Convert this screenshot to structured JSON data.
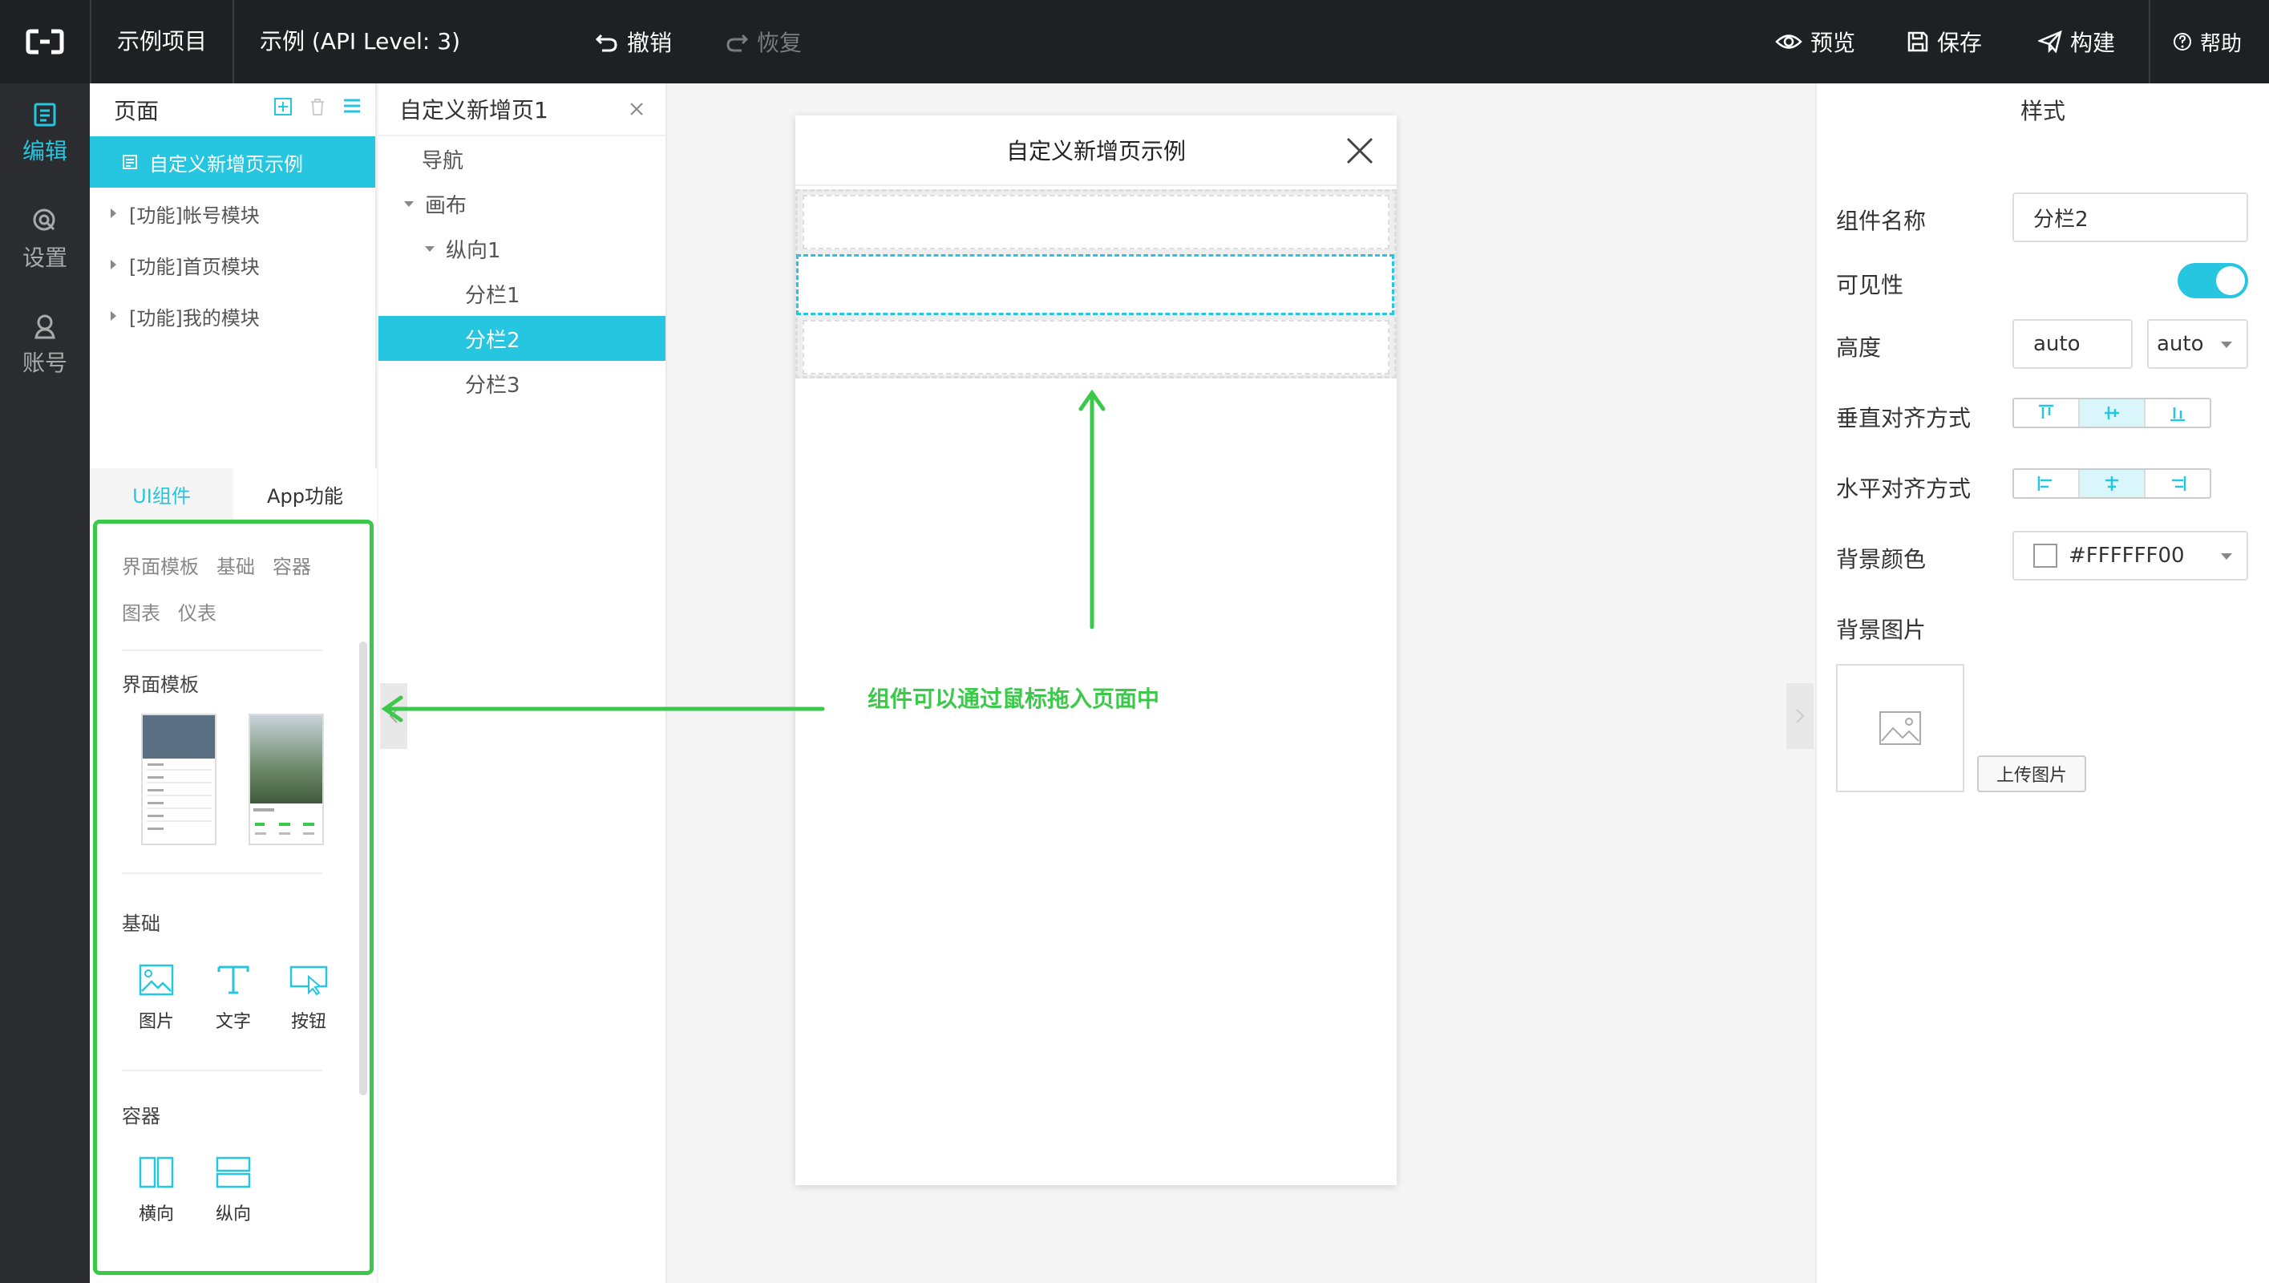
{
  "topbar": {
    "project": "示例项目",
    "example": "示例 (API Level: 3)",
    "undo": "撤销",
    "redo": "恢复",
    "preview": "预览",
    "save": "保存",
    "build": "构建",
    "help": "帮助"
  },
  "leftnav": {
    "edit": "编辑",
    "settings": "设置",
    "account": "账号"
  },
  "pages": {
    "header": "页面",
    "items": [
      {
        "label": "自定义新增页示例"
      },
      {
        "label": "[功能]帐号模块"
      },
      {
        "label": "[功能]首页模块"
      },
      {
        "label": "[功能]我的模块"
      }
    ]
  },
  "comptabs": {
    "ui": "UI组件",
    "app": "App功能"
  },
  "complib": {
    "cat1": "界面模板",
    "cat2": "基础",
    "cat3": "容器",
    "cat4": "图表",
    "cat5": "仪表",
    "sect_template": "界面模板",
    "sect_basic": "基础",
    "sect_container": "容器",
    "basic": [
      "图片",
      "文字",
      "按钮"
    ],
    "container": [
      "横向",
      "纵向"
    ]
  },
  "tree": {
    "title": "自定义新增页1",
    "nav": "导航",
    "canvas": "画布",
    "vertical": "纵向1",
    "col1": "分栏1",
    "col2": "分栏2",
    "col3": "分栏3"
  },
  "phone": {
    "title": "自定义新增页示例"
  },
  "annotation": "组件可以通过鼠标拖入页面中",
  "style": {
    "header": "样式",
    "name_label": "组件名称",
    "name_value": "分栏2",
    "visible_label": "可见性",
    "visible": true,
    "height_label": "高度",
    "height_value": "auto",
    "height_unit": "auto",
    "valign_label": "垂直对齐方式",
    "halign_label": "水平对齐方式",
    "bg_color_label": "背景颜色",
    "bg_color_value": "#FFFFFF00",
    "bg_image_label": "背景图片",
    "upload": "上传图片"
  },
  "colors": {
    "accent": "#26c6e0",
    "annotation": "#3cc84b",
    "topbar": "#1e2023"
  }
}
